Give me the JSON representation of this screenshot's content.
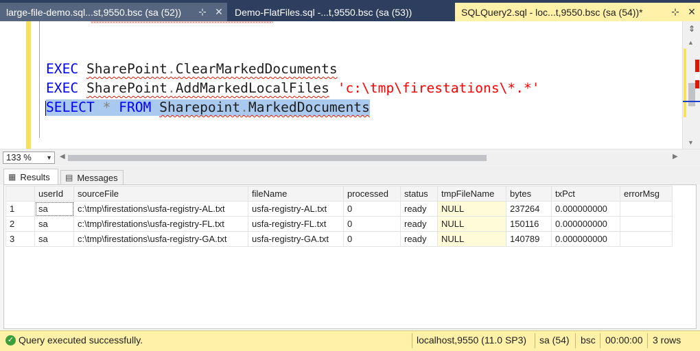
{
  "tabs": [
    {
      "title": "large-file-demo.sql...st,9550.bsc (sa (52))",
      "pin": "⊹",
      "close": "✕"
    },
    {
      "title": "Demo-FlatFiles.sql -...t,9550.bsc (sa (53))"
    },
    {
      "title": "SQLQuery2.sql - loc...t,9550.bsc (sa (54))*",
      "pin": "⊹",
      "close": "✕"
    }
  ],
  "editor": {
    "line1": {
      "kw": "EXEC",
      "obj": "SharePoint",
      "dot": ".",
      "proc": "ClearMarkedDocuments"
    },
    "line2": {
      "kw": "EXEC",
      "obj": "SharePoint",
      "dot": ".",
      "proc": "AddMarkedLocalFiles",
      "arg": "'c:\\tmp\\firestations\\*.*'"
    },
    "line3": {
      "kw1": "SELECT",
      "star": "*",
      "kw2": "FROM",
      "obj": "Sharepoint",
      "dot": ".",
      "tbl": "MarkedDocuments"
    }
  },
  "zoom": {
    "value": "133 %"
  },
  "results_tabs": {
    "results": "Results",
    "messages": "Messages"
  },
  "grid": {
    "columns": [
      "userId",
      "sourceFile",
      "fileName",
      "processed",
      "status",
      "tmpFileName",
      "bytes",
      "txPct",
      "errorMsg"
    ],
    "rows": [
      {
        "n": "1",
        "userId": "sa",
        "sourceFile": "c:\\tmp\\firestations\\usfa-registry-AL.txt",
        "fileName": "usfa-registry-AL.txt",
        "processed": "0",
        "status": "ready",
        "tmpFileName": "NULL",
        "bytes": "237264",
        "txPct": "0.000000000",
        "errorMsg": ""
      },
      {
        "n": "2",
        "userId": "sa",
        "sourceFile": "c:\\tmp\\firestations\\usfa-registry-FL.txt",
        "fileName": "usfa-registry-FL.txt",
        "processed": "0",
        "status": "ready",
        "tmpFileName": "NULL",
        "bytes": "150116",
        "txPct": "0.000000000",
        "errorMsg": ""
      },
      {
        "n": "3",
        "userId": "sa",
        "sourceFile": "c:\\tmp\\firestations\\usfa-registry-GA.txt",
        "fileName": "usfa-registry-GA.txt",
        "processed": "0",
        "status": "ready",
        "tmpFileName": "NULL",
        "bytes": "140789",
        "txPct": "0.000000000",
        "errorMsg": ""
      }
    ]
  },
  "status": {
    "message": "Query executed successfully.",
    "server": "localhost,9550 (11.0 SP3)",
    "user": "sa (54)",
    "database": "bsc",
    "elapsed": "00:00:00",
    "rows": "3 rows"
  },
  "colors": {
    "accent": "#2d3e5e",
    "status_bg": "#fff1a8",
    "keyword": "#0000ff",
    "string": "#ff0000",
    "selection": "#a9c9ee"
  }
}
